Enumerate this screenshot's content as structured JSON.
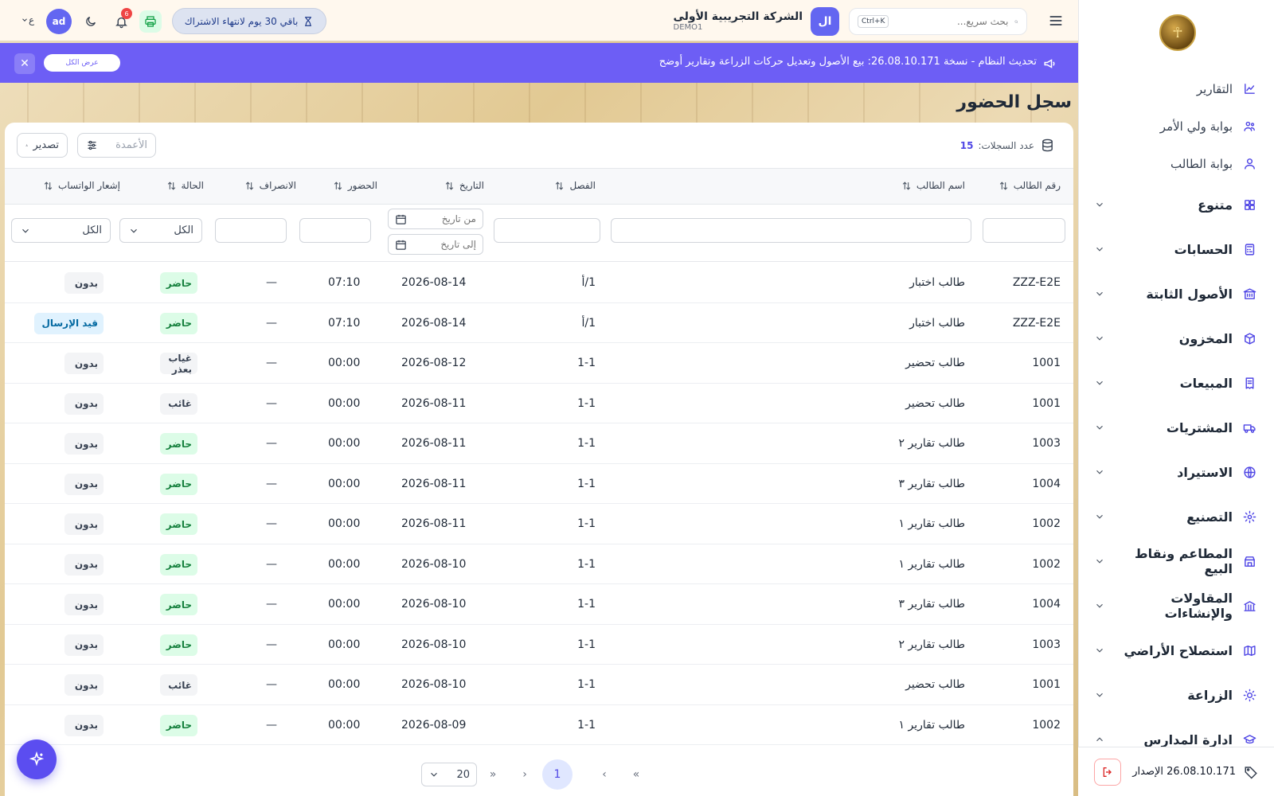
{
  "sidebar": {
    "logo_icon": "egyptian-emblem",
    "links": [
      {
        "label": "التقارير",
        "icon": "chart-icon"
      },
      {
        "label": "بوابة ولي الأمر",
        "icon": "parent-icon"
      },
      {
        "label": "بوابة الطالب",
        "icon": "user-icon"
      }
    ],
    "groups": [
      {
        "label": "متنوع",
        "icon": "grid-icon"
      },
      {
        "label": "الحسابات",
        "icon": "calculator-icon"
      },
      {
        "label": "الأصول الثابتة",
        "icon": "building-icon"
      },
      {
        "label": "المخزون",
        "icon": "box-icon"
      },
      {
        "label": "المبيعات",
        "icon": "receipt-icon"
      },
      {
        "label": "المشتريات",
        "icon": "truck-icon"
      },
      {
        "label": "الاستيراد",
        "icon": "globe-icon"
      },
      {
        "label": "التصنيع",
        "icon": "gear-icon"
      },
      {
        "label": "المطاعم ونقاط البيع",
        "icon": "store-icon"
      },
      {
        "label": "المقاولات والإنشاءات",
        "icon": "bank-icon"
      },
      {
        "label": "استصلاح الأراضي",
        "icon": "map-icon"
      },
      {
        "label": "الزراعة",
        "icon": "sun-icon"
      },
      {
        "label": "ادارة المدارس",
        "icon": "school-icon"
      }
    ],
    "version": "26.08.10.171 الإصدار"
  },
  "topbar": {
    "search_placeholder": "بحث سريع...",
    "shortcut": "Ctrl+K",
    "company_initials": "ال",
    "company_name": "الشركة التجريبية الأولى",
    "company_code": "DEMO1",
    "subscription": "باقي 30 يوم لانتهاء الاشتراك",
    "notif_count": "6",
    "user_initials": "ad",
    "lang": "ع"
  },
  "announcement": {
    "text": "تحديث النظام - نسخة 26.08.10.171: بيع الأصول وتعديل حركات الزراعة وتقارير أوضح",
    "button": "عرض الكل"
  },
  "page": {
    "title": "سجل الحضور",
    "count_label": "عدد السجلات:",
    "count": "15",
    "columns_btn": "الأعمدة",
    "export_btn": "تصدير"
  },
  "table": {
    "headers": {
      "id": "رقم الطالب",
      "name": "اسم الطالب",
      "class": "الفصل",
      "date": "التاريخ",
      "in": "الحضور",
      "out": "الانصراف",
      "status": "الحالة",
      "whatsapp": "إشعار الواتساب"
    },
    "filters": {
      "from_date": "من تاريخ",
      "to_date": "إلى تاريخ",
      "status_all": "الكل",
      "whatsapp_all": "الكل"
    },
    "rows": [
      {
        "id": "ZZZ-E2E",
        "name": "طالب اختبار",
        "class": "1/أ",
        "date": "2026-08-14",
        "in": "07:10",
        "out": "—",
        "status": "حاضر",
        "status_type": "present",
        "wa": "بدون",
        "wa_type": "none"
      },
      {
        "id": "ZZZ-E2E",
        "name": "طالب اختبار",
        "class": "1/أ",
        "date": "2026-08-14",
        "in": "07:10",
        "out": "—",
        "status": "حاضر",
        "status_type": "present",
        "wa": "قيد الإرسال",
        "wa_type": "pending"
      },
      {
        "id": "1001",
        "name": "طالب تحضير",
        "class": "1-1",
        "date": "2026-08-12",
        "in": "00:00",
        "out": "—",
        "status": "غياب بعذر",
        "status_type": "excuse",
        "wa": "بدون",
        "wa_type": "none"
      },
      {
        "id": "1001",
        "name": "طالب تحضير",
        "class": "1-1",
        "date": "2026-08-11",
        "in": "00:00",
        "out": "—",
        "status": "غائب",
        "status_type": "absent",
        "wa": "بدون",
        "wa_type": "none"
      },
      {
        "id": "1003",
        "name": "طالب تقارير ٢",
        "class": "1-1",
        "date": "2026-08-11",
        "in": "00:00",
        "out": "—",
        "status": "حاضر",
        "status_type": "present",
        "wa": "بدون",
        "wa_type": "none"
      },
      {
        "id": "1004",
        "name": "طالب تقارير ٣",
        "class": "1-1",
        "date": "2026-08-11",
        "in": "00:00",
        "out": "—",
        "status": "حاضر",
        "status_type": "present",
        "wa": "بدون",
        "wa_type": "none"
      },
      {
        "id": "1002",
        "name": "طالب تقارير ١",
        "class": "1-1",
        "date": "2026-08-11",
        "in": "00:00",
        "out": "—",
        "status": "حاضر",
        "status_type": "present",
        "wa": "بدون",
        "wa_type": "none"
      },
      {
        "id": "1002",
        "name": "طالب تقارير ١",
        "class": "1-1",
        "date": "2026-08-10",
        "in": "00:00",
        "out": "—",
        "status": "حاضر",
        "status_type": "present",
        "wa": "بدون",
        "wa_type": "none"
      },
      {
        "id": "1004",
        "name": "طالب تقارير ٣",
        "class": "1-1",
        "date": "2026-08-10",
        "in": "00:00",
        "out": "—",
        "status": "حاضر",
        "status_type": "present",
        "wa": "بدون",
        "wa_type": "none"
      },
      {
        "id": "1003",
        "name": "طالب تقارير ٢",
        "class": "1-1",
        "date": "2026-08-10",
        "in": "00:00",
        "out": "—",
        "status": "حاضر",
        "status_type": "present",
        "wa": "بدون",
        "wa_type": "none"
      },
      {
        "id": "1001",
        "name": "طالب تحضير",
        "class": "1-1",
        "date": "2026-08-10",
        "in": "00:00",
        "out": "—",
        "status": "غائب",
        "status_type": "absent",
        "wa": "بدون",
        "wa_type": "none"
      },
      {
        "id": "1002",
        "name": "طالب تقارير ١",
        "class": "1-1",
        "date": "2026-08-09",
        "in": "00:00",
        "out": "—",
        "status": "حاضر",
        "status_type": "present",
        "wa": "بدون",
        "wa_type": "none"
      }
    ]
  },
  "pagination": {
    "current": "1",
    "page_size": "20"
  }
}
